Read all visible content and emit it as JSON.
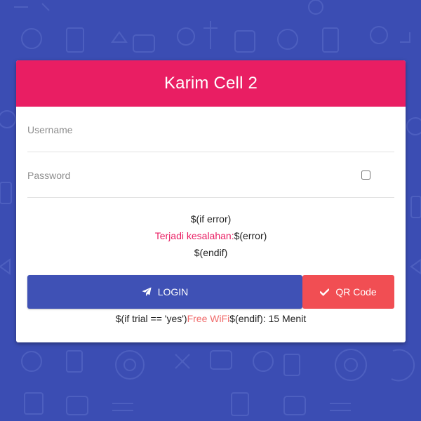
{
  "colors": {
    "background": "#3b4db3",
    "header": "#e91e63",
    "login_button": "#3f51b5",
    "qr_button": "#f14e53",
    "error_text": "#e91e63",
    "free_wifi_text": "#f06b6b"
  },
  "header": {
    "title": "Karim Cell 2"
  },
  "form": {
    "username_placeholder": "Username",
    "password_placeholder": "Password",
    "show_password_checked": false
  },
  "messages": {
    "if_error": "$(if error)",
    "error_label": "Terjadi kesalahan:",
    "error_value": "$(error)",
    "endif": "$(endif)"
  },
  "buttons": {
    "login_icon": "paper-plane-icon",
    "login_label": "LOGIN",
    "qr_icon": "check-icon",
    "qr_label": "QR Code"
  },
  "trial": {
    "prefix": "$(if trial == 'yes')",
    "free_label": "Free WiFi",
    "suffix": "$(endif): 15 Menit"
  }
}
